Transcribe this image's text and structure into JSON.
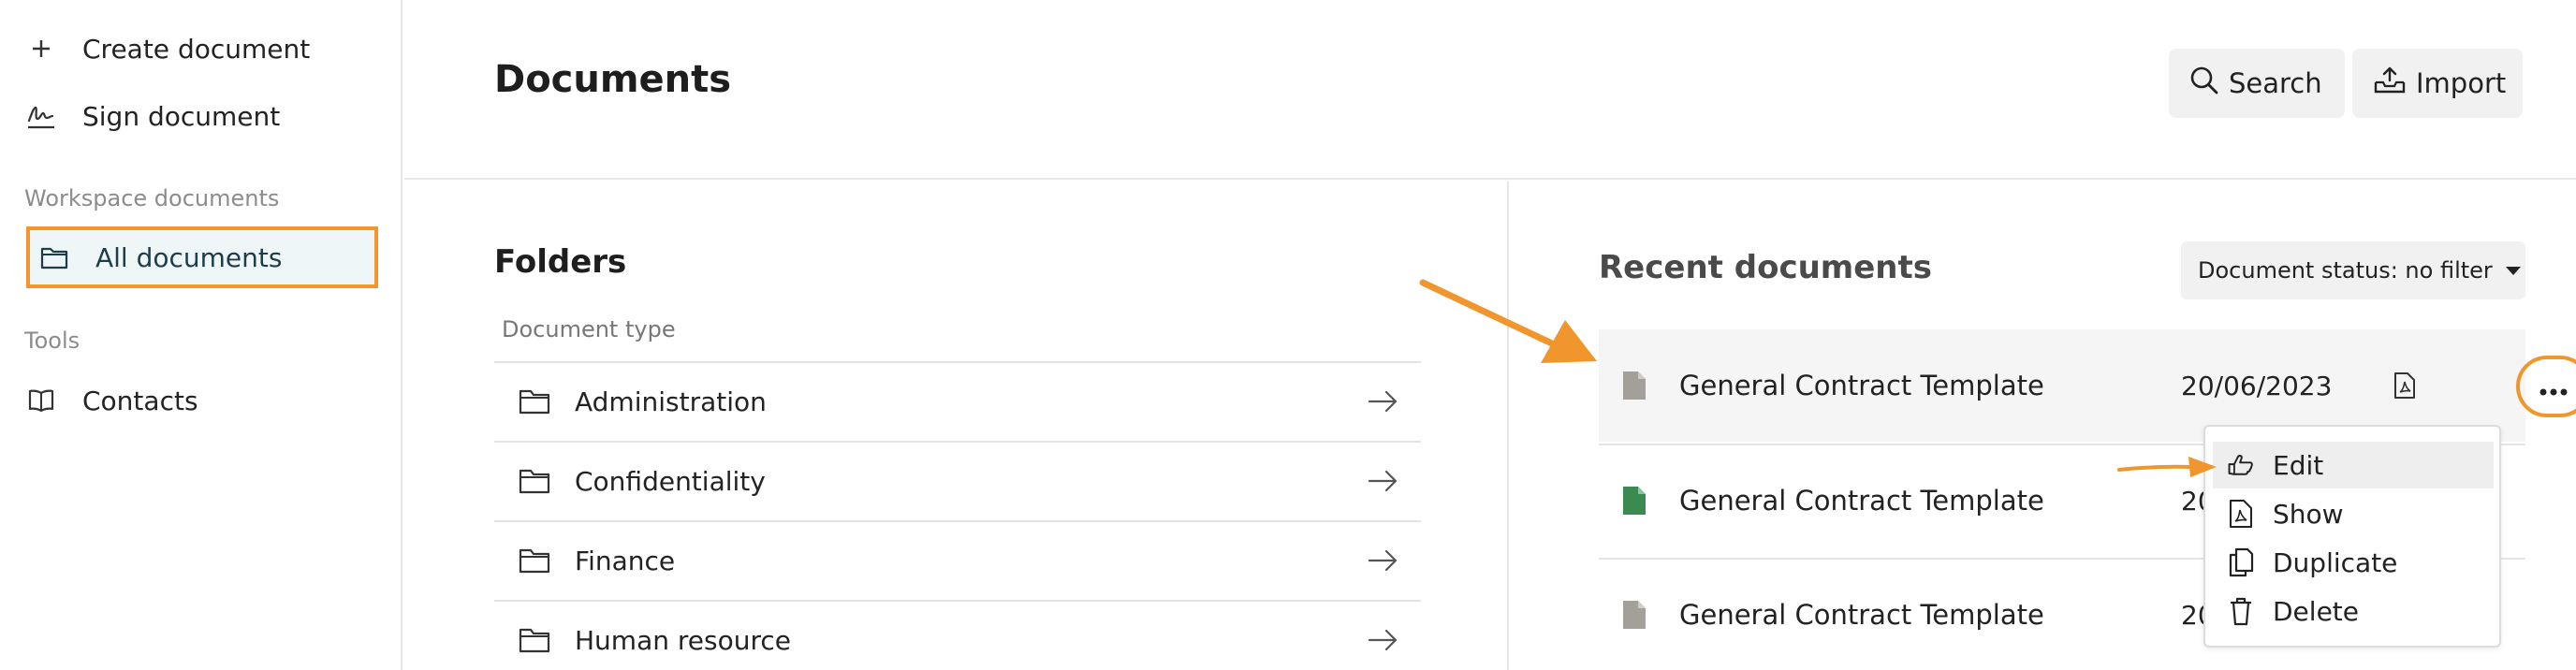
{
  "sidebar": {
    "create_label": "Create document",
    "sign_label": "Sign document",
    "section_workspace": "Workspace documents",
    "all_documents_label": "All documents",
    "section_tools": "Tools",
    "contacts_label": "Contacts"
  },
  "header": {
    "title": "Documents",
    "search_label": "Search",
    "import_label": "Import"
  },
  "folders": {
    "title": "Folders",
    "column_label": "Document type",
    "items": [
      {
        "name": "Administration"
      },
      {
        "name": "Confidentiality"
      },
      {
        "name": "Finance"
      },
      {
        "name": "Human resource"
      }
    ]
  },
  "recent": {
    "title": "Recent documents",
    "status_filter_label": "Document status: no filter",
    "documents": [
      {
        "name": "General Contract Template",
        "date": "20/06/2023",
        "icon_color": "#a39f99"
      },
      {
        "name": "General Contract Template",
        "date": "20",
        "icon_color": "#3a8a52"
      },
      {
        "name": "General Contract Template",
        "date": "20",
        "icon_color": "#a39f99"
      }
    ]
  },
  "menu": {
    "items": [
      {
        "label": "Edit",
        "icon": "hand-pointer-icon"
      },
      {
        "label": "Show",
        "icon": "pdf-file-icon"
      },
      {
        "label": "Duplicate",
        "icon": "copy-icon"
      },
      {
        "label": "Delete",
        "icon": "trash-icon"
      }
    ]
  },
  "colors": {
    "accent_orange": "#f0962c",
    "active_bg": "#eef6f8",
    "button_bg": "#f1f1f1"
  }
}
